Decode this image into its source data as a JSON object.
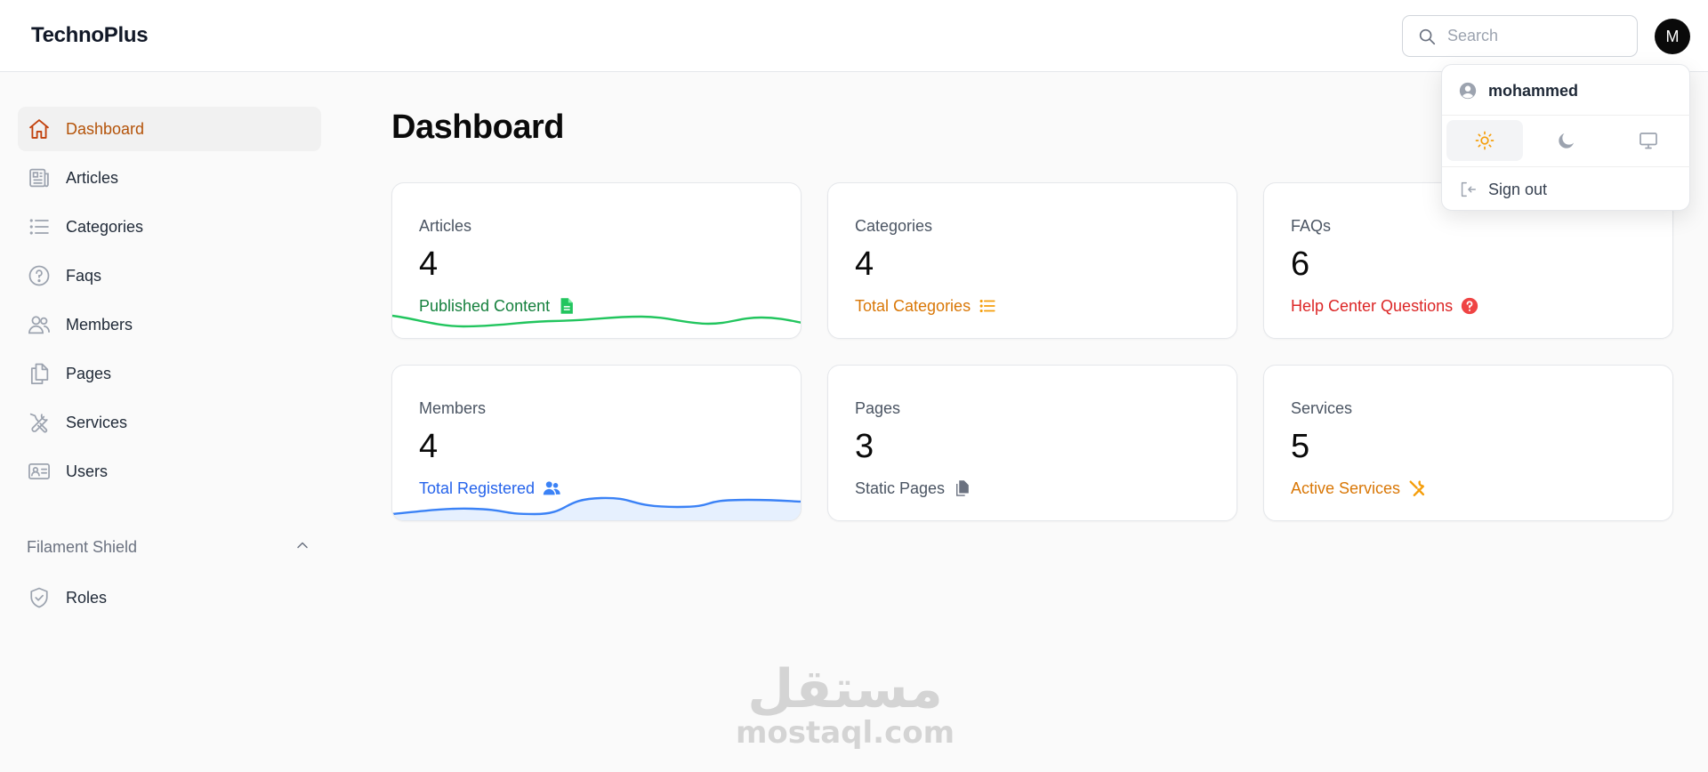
{
  "app": {
    "brand": "TechnoPlus"
  },
  "search": {
    "placeholder": "Search"
  },
  "user": {
    "avatar_initial": "M",
    "name": "mohammed"
  },
  "colors": {
    "primary": "#b45309",
    "success": "#16a34a",
    "warning": "#d97706",
    "danger": "#dc2626",
    "info": "#2563eb",
    "gray": "#6b7280"
  },
  "sidebar": {
    "items": [
      {
        "label": "Dashboard",
        "icon": "home-icon",
        "active": true
      },
      {
        "label": "Articles",
        "icon": "newspaper-icon"
      },
      {
        "label": "Categories",
        "icon": "list-icon"
      },
      {
        "label": "Faqs",
        "icon": "question-circle-icon"
      },
      {
        "label": "Members",
        "icon": "users-icon"
      },
      {
        "label": "Pages",
        "icon": "documents-icon"
      },
      {
        "label": "Services",
        "icon": "wrench-screwdriver-icon"
      },
      {
        "label": "Users",
        "icon": "id-card-icon"
      }
    ],
    "groups": [
      {
        "label": "Filament Shield",
        "expanded": true,
        "items": [
          {
            "label": "Roles",
            "icon": "shield-check-icon"
          }
        ]
      }
    ]
  },
  "main": {
    "title": "Dashboard",
    "stats": [
      {
        "label": "Articles",
        "value": "4",
        "description": "Published Content",
        "icon": "document-text-icon",
        "color": "success",
        "chart": [
          5,
          3,
          4,
          5,
          6,
          4,
          6,
          4
        ]
      },
      {
        "label": "Categories",
        "value": "4",
        "description": "Total Categories",
        "icon": "list-bullet-icon",
        "color": "warning"
      },
      {
        "label": "FAQs",
        "value": "6",
        "description": "Help Center Questions",
        "icon": "question-mark-circle-icon",
        "color": "danger"
      },
      {
        "label": "Members",
        "value": "4",
        "description": "Total Registered",
        "icon": "user-group-icon",
        "color": "info",
        "chart": [
          2,
          4,
          2,
          5,
          3,
          4,
          4
        ]
      },
      {
        "label": "Pages",
        "value": "3",
        "description": "Static Pages",
        "icon": "document-duplicate-icon",
        "color": "gray"
      },
      {
        "label": "Services",
        "value": "5",
        "description": "Active Services",
        "icon": "wrench-screwdriver-icon",
        "color": "warning"
      }
    ]
  },
  "user_menu": {
    "name": "mohammed",
    "theme_options": [
      {
        "name": "light",
        "icon": "sun-icon",
        "active": true
      },
      {
        "name": "dark",
        "icon": "moon-icon"
      },
      {
        "name": "system",
        "icon": "monitor-icon"
      }
    ],
    "sign_out_label": "Sign out"
  },
  "watermark": {
    "arabic": "مستقل",
    "latin": "mostaql.com"
  }
}
